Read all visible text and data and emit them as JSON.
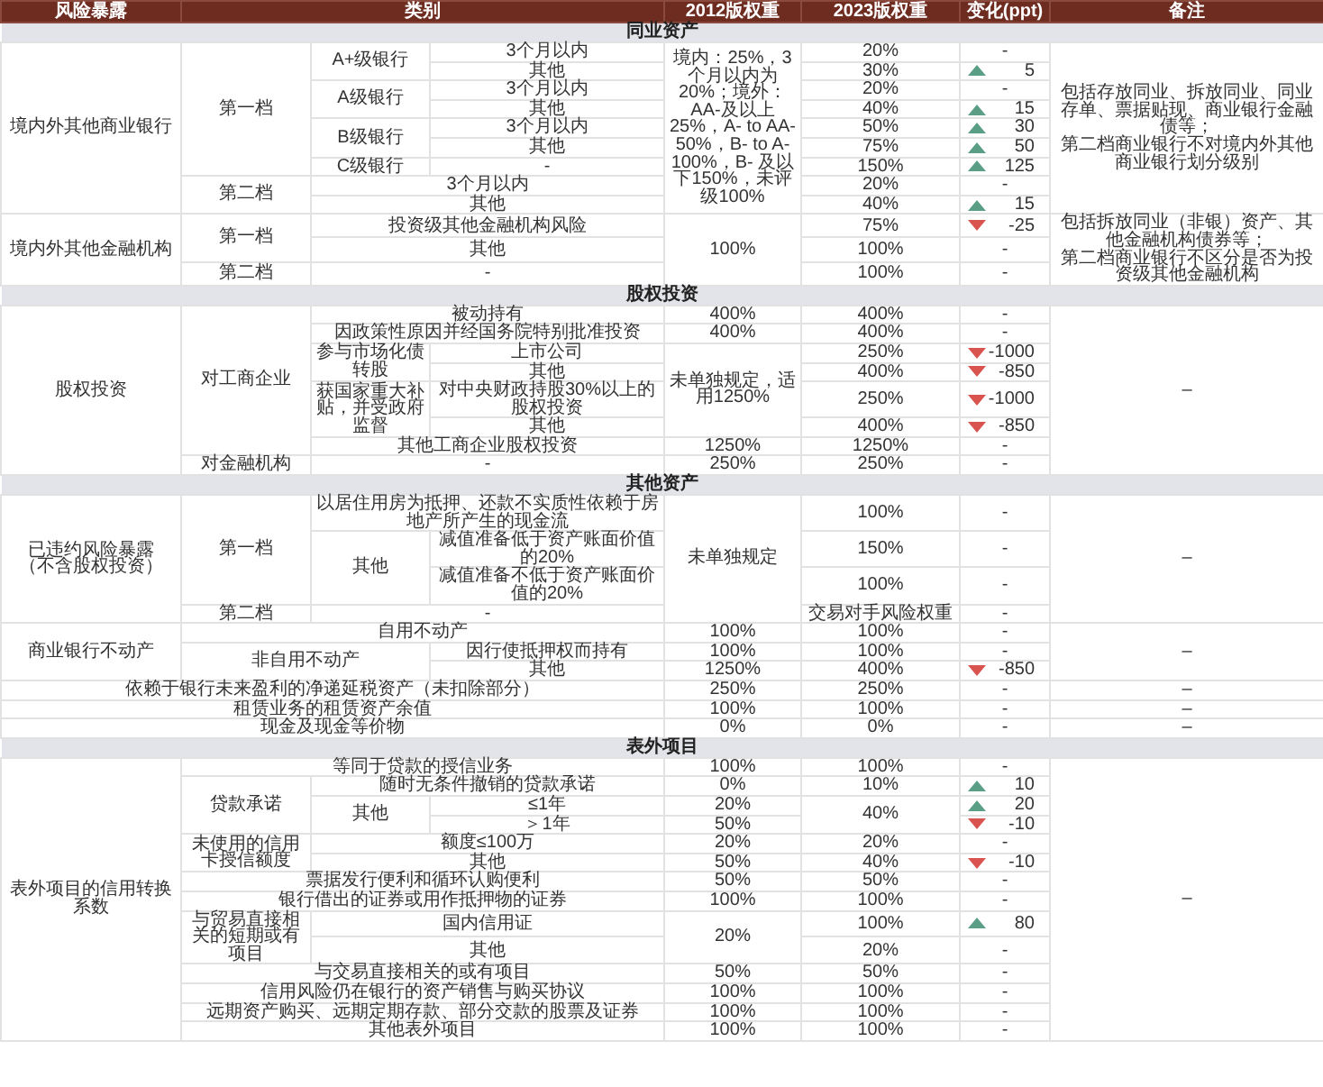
{
  "columns": [
    {
      "label": "风险暴露"
    },
    {
      "label": "类别",
      "colspan": 3
    },
    {
      "label": "2012版权重"
    },
    {
      "label": "2023版权重"
    },
    {
      "label": "变化(ppt)"
    },
    {
      "label": "备注"
    }
  ],
  "sections": [
    {
      "title": "同业资产",
      "rows": [
        {
          "cells": [
            {
              "text": "境内外其他商业银行",
              "rowspan": 9
            },
            {
              "text": "第一档",
              "rowspan": 7
            },
            {
              "text": "A+级银行",
              "rowspan": 2
            },
            {
              "text": "3个月以内"
            },
            {
              "text": "境内：25%，3个月以内为20%；境外：AA-及以上25%，A- to AA-50%，B- to A-100%，B- 及以下150%，未评级100%",
              "rowspan": 9
            },
            {
              "text": "20%"
            },
            {
              "text": "-"
            },
            {
              "lines": [
                "包括存放同业、拆放同业、同业存单、票据贴现、商业银行金融债等；",
                "第二档商业银行不对境内外其他商业银行划分级别"
              ],
              "rowspan": 9
            }
          ]
        },
        {
          "cells": [
            {
              "text": "其他"
            },
            {
              "text": "30%"
            },
            {
              "text": "5",
              "kind": "increase"
            }
          ]
        },
        {
          "cells": [
            {
              "text": "A级银行",
              "rowspan": 2
            },
            {
              "text": "3个月以内"
            },
            {
              "text": "20%"
            },
            {
              "text": "-"
            }
          ]
        },
        {
          "cells": [
            {
              "text": "其他"
            },
            {
              "text": "40%"
            },
            {
              "text": "15",
              "kind": "increase"
            }
          ]
        },
        {
          "cells": [
            {
              "text": "B级银行",
              "rowspan": 2
            },
            {
              "text": "3个月以内"
            },
            {
              "text": "50%"
            },
            {
              "text": "30",
              "kind": "increase"
            }
          ]
        },
        {
          "cells": [
            {
              "text": "其他"
            },
            {
              "text": "75%"
            },
            {
              "text": "50",
              "kind": "increase"
            }
          ]
        },
        {
          "cells": [
            {
              "text": "C级银行"
            },
            {
              "text": "-"
            },
            {
              "text": "150%"
            },
            {
              "text": "125",
              "kind": "increase"
            }
          ]
        },
        {
          "cells": [
            {
              "text": "第二档",
              "rowspan": 2
            },
            {
              "text": "3个月以内",
              "colspan": 2
            },
            {
              "text": "20%"
            },
            {
              "text": "-"
            }
          ]
        },
        {
          "cells": [
            {
              "text": "其他",
              "colspan": 2
            },
            {
              "text": "40%"
            },
            {
              "text": "15",
              "kind": "increase"
            }
          ]
        },
        {
          "cells": [
            {
              "text": "境内外其他金融机构",
              "rowspan": 3
            },
            {
              "text": "第一档",
              "rowspan": 2
            },
            {
              "text": "投资级其他金融机构风险",
              "colspan": 2
            },
            {
              "text": "100%",
              "rowspan": 3
            },
            {
              "text": "75%"
            },
            {
              "text": "-25",
              "kind": "decrease"
            },
            {
              "lines": [
                "包括拆放同业（非银）资产、其他金融机构债券等；",
                "第二档商业银行不区分是否为投资级其他金融机构"
              ],
              "rowspan": 3
            }
          ]
        },
        {
          "cells": [
            {
              "text": "其他",
              "colspan": 2
            },
            {
              "text": "100%"
            },
            {
              "text": "-"
            }
          ]
        },
        {
          "cells": [
            {
              "text": "第二档"
            },
            {
              "text": "-",
              "colspan": 2
            },
            {
              "text": "100%"
            },
            {
              "text": "-"
            }
          ]
        }
      ]
    },
    {
      "title": "股权投资",
      "rows": [
        {
          "cells": [
            {
              "text": "股权投资",
              "rowspan": 8
            },
            {
              "text": "对工商企业",
              "rowspan": 7
            },
            {
              "text": "被动持有",
              "colspan": 2
            },
            {
              "text": "400%"
            },
            {
              "text": "400%"
            },
            {
              "text": "-"
            },
            {
              "text": "–",
              "rowspan": 8
            }
          ]
        },
        {
          "cells": [
            {
              "text": "因政策性原因并经国务院特别批准投资",
              "colspan": 2
            },
            {
              "text": "400%"
            },
            {
              "text": "400%"
            },
            {
              "text": "-"
            }
          ]
        },
        {
          "cells": [
            {
              "text": "参与市场化债转股",
              "rowspan": 2
            },
            {
              "text": "上市公司"
            },
            {
              "text": "未单独规定，适用1250%",
              "rowspan": 4
            },
            {
              "text": "250%"
            },
            {
              "text": "-1000",
              "kind": "decrease"
            }
          ]
        },
        {
          "cells": [
            {
              "text": "其他"
            },
            {
              "text": "400%"
            },
            {
              "text": "-850",
              "kind": "decrease"
            }
          ]
        },
        {
          "cells": [
            {
              "text": "获国家重大补贴，并受政府监督",
              "rowspan": 2
            },
            {
              "text": "对中央财政持股30%以上的股权投资"
            },
            {
              "text": "250%"
            },
            {
              "text": "-1000",
              "kind": "decrease"
            }
          ]
        },
        {
          "cells": [
            {
              "text": "其他"
            },
            {
              "text": "400%"
            },
            {
              "text": "-850",
              "kind": "decrease"
            }
          ]
        },
        {
          "cells": [
            {
              "text": "其他工商企业股权投资",
              "colspan": 2
            },
            {
              "text": "1250%"
            },
            {
              "text": "1250%"
            },
            {
              "text": "-"
            }
          ]
        },
        {
          "cells": [
            {
              "text": "对金融机构"
            },
            {
              "text": "-",
              "colspan": 2
            },
            {
              "text": "250%"
            },
            {
              "text": "250%"
            },
            {
              "text": "-"
            }
          ]
        }
      ]
    },
    {
      "title": "其他资产",
      "rows": [
        {
          "cells": [
            {
              "lines": [
                "已违约风险暴露",
                "（不含股权投资）"
              ],
              "rowspan": 4
            },
            {
              "text": "第一档",
              "rowspan": 3
            },
            {
              "text": "以居住用房为抵押、还款不实质性依赖于房地产所产生的现金流",
              "colspan": 2
            },
            {
              "text": "未单独规定",
              "rowspan": 4
            },
            {
              "text": "100%"
            },
            {
              "text": "-"
            },
            {
              "text": "–",
              "rowspan": 4
            }
          ]
        },
        {
          "cells": [
            {
              "text": "其他",
              "rowspan": 2
            },
            {
              "text": "减值准备低于资产账面价值的20%"
            },
            {
              "text": "150%"
            },
            {
              "text": "-"
            }
          ]
        },
        {
          "cells": [
            {
              "text": "减值准备不低于资产账面价值的20%"
            },
            {
              "text": "100%"
            },
            {
              "text": "-"
            }
          ]
        },
        {
          "cells": [
            {
              "text": "第二档"
            },
            {
              "text": "-",
              "colspan": 2
            },
            {
              "text": "交易对手风险权重"
            },
            {
              "text": "-"
            }
          ]
        },
        {
          "cells": [
            {
              "text": "商业银行不动产",
              "rowspan": 3
            },
            {
              "text": "自用不动产",
              "colspan": 3
            },
            {
              "text": "100%"
            },
            {
              "text": "100%"
            },
            {
              "text": "-"
            },
            {
              "text": "–",
              "rowspan": 3
            }
          ]
        },
        {
          "cells": [
            {
              "text": "非自用不动产",
              "colspan": 2,
              "rowspan": 2
            },
            {
              "text": "因行使抵押权而持有"
            },
            {
              "text": "100%"
            },
            {
              "text": "100%"
            },
            {
              "text": "-"
            }
          ]
        },
        {
          "cells": [
            {
              "text": "其他"
            },
            {
              "text": "1250%"
            },
            {
              "text": "400%"
            },
            {
              "text": "-850",
              "kind": "decrease"
            }
          ]
        },
        {
          "cells": [
            {
              "text": "依赖于银行未来盈利的净递延税资产（未扣除部分）",
              "colspan": 4
            },
            {
              "text": "250%"
            },
            {
              "text": "250%"
            },
            {
              "text": "-"
            },
            {
              "text": "–"
            }
          ]
        },
        {
          "cells": [
            {
              "text": "租赁业务的租赁资产余值",
              "colspan": 4
            },
            {
              "text": "100%"
            },
            {
              "text": "100%"
            },
            {
              "text": "-"
            },
            {
              "text": "–"
            }
          ]
        },
        {
          "cells": [
            {
              "text": "现金及现金等价物",
              "colspan": 4
            },
            {
              "text": "0%"
            },
            {
              "text": "0%"
            },
            {
              "text": "-"
            },
            {
              "text": "–"
            }
          ]
        }
      ]
    },
    {
      "title": "表外项目",
      "rows": [
        {
          "cells": [
            {
              "text": "表外项目的信用转换系数",
              "rowspan": 14
            },
            {
              "text": "等同于贷款的授信业务",
              "colspan": 3
            },
            {
              "text": "100%"
            },
            {
              "text": "100%"
            },
            {
              "text": "-"
            },
            {
              "text": "–",
              "rowspan": 14
            }
          ]
        },
        {
          "cells": [
            {
              "text": "贷款承诺",
              "rowspan": 3
            },
            {
              "text": "随时无条件撤销的贷款承诺",
              "colspan": 2
            },
            {
              "text": "0%"
            },
            {
              "text": "10%"
            },
            {
              "text": "10",
              "kind": "increase"
            }
          ]
        },
        {
          "cells": [
            {
              "text": "其他",
              "rowspan": 2
            },
            {
              "text": "≤1年"
            },
            {
              "text": "20%"
            },
            {
              "text": "40%",
              "rowspan": 2
            },
            {
              "text": "20",
              "kind": "increase"
            }
          ]
        },
        {
          "cells": [
            {
              "text": "＞1年"
            },
            {
              "text": "50%"
            },
            {
              "text": "-10",
              "kind": "decrease"
            }
          ]
        },
        {
          "cells": [
            {
              "text": "未使用的信用卡授信额度",
              "rowspan": 2
            },
            {
              "text": "额度≤100万",
              "colspan": 2
            },
            {
              "text": "20%"
            },
            {
              "text": "20%"
            },
            {
              "text": "-"
            }
          ]
        },
        {
          "cells": [
            {
              "text": "其他",
              "colspan": 2
            },
            {
              "text": "50%"
            },
            {
              "text": "40%"
            },
            {
              "text": "-10",
              "kind": "decrease"
            }
          ]
        },
        {
          "cells": [
            {
              "text": "票据发行便利和循环认购便利",
              "colspan": 3
            },
            {
              "text": "50%"
            },
            {
              "text": "50%"
            },
            {
              "text": "-"
            }
          ]
        },
        {
          "cells": [
            {
              "text": "银行借出的证券或用作抵押物的证券",
              "colspan": 3
            },
            {
              "text": "100%"
            },
            {
              "text": "100%"
            },
            {
              "text": "-"
            }
          ]
        },
        {
          "cells": [
            {
              "text": "与贸易直接相关的短期或有项目",
              "rowspan": 2
            },
            {
              "text": "国内信用证",
              "colspan": 2
            },
            {
              "text": "20%",
              "rowspan": 2
            },
            {
              "text": "100%"
            },
            {
              "text": "80",
              "kind": "increase"
            }
          ]
        },
        {
          "cells": [
            {
              "text": "其他",
              "colspan": 2
            },
            {
              "text": "20%"
            },
            {
              "text": "-"
            }
          ]
        },
        {
          "cells": [
            {
              "text": "与交易直接相关的或有项目",
              "colspan": 3
            },
            {
              "text": "50%"
            },
            {
              "text": "50%"
            },
            {
              "text": "-"
            }
          ]
        },
        {
          "cells": [
            {
              "text": "信用风险仍在银行的资产销售与购买协议",
              "colspan": 3
            },
            {
              "text": "100%"
            },
            {
              "text": "100%"
            },
            {
              "text": "-"
            }
          ]
        },
        {
          "cells": [
            {
              "text": "远期资产购买、远期定期存款、部分交款的股票及证券",
              "colspan": 3
            },
            {
              "text": "100%"
            },
            {
              "text": "100%"
            },
            {
              "text": "-"
            }
          ]
        },
        {
          "cells": [
            {
              "text": "其他表外项目",
              "colspan": 3
            },
            {
              "text": "100%"
            },
            {
              "text": "100%"
            },
            {
              "text": "-"
            }
          ]
        }
      ]
    }
  ]
}
